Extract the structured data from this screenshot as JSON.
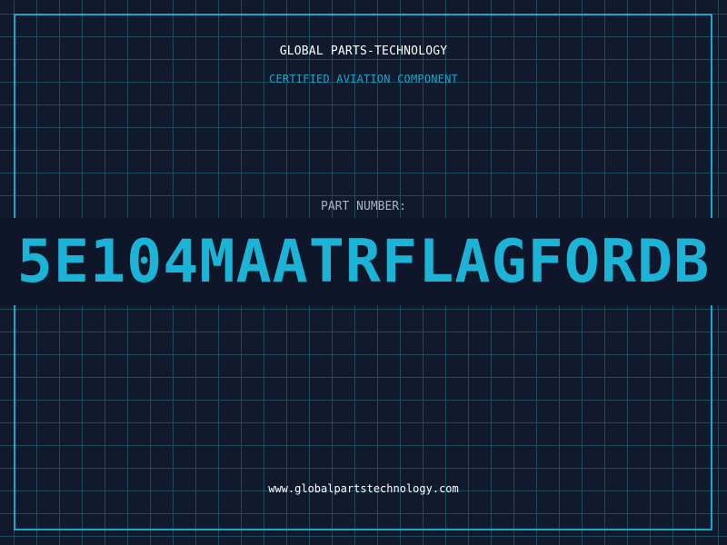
{
  "header": {
    "company": "GLOBAL PARTS-TECHNOLOGY",
    "subtitle": "CERTIFIED AVIATION COMPONENT"
  },
  "part": {
    "label": "PART NUMBER:",
    "number": "5E104MAATRFLAGFORDB"
  },
  "footer": {
    "url": "www.globalpartstechnology.com"
  },
  "colors": {
    "background": "#11192d",
    "grid": "#1e4a5e",
    "accent": "#1ba7c9",
    "part_number": "#1bb4d6"
  }
}
